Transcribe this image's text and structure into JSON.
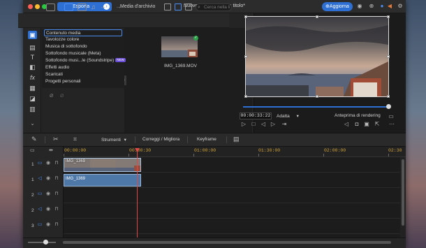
{
  "titlebar": {
    "export_label": "Esporta",
    "export_chevron": "›",
    "project_title": "Nuovo progetto senza titolo*",
    "update_label": "⊕Aggiorna",
    "back_icon": "←",
    "forward_icon": "→"
  },
  "library": {
    "view_dropdown": "Media d'archivio",
    "search_placeholder": "Cerca nella li",
    "categories": [
      "Contenuto media",
      "Tavolozze colore",
      "Musica di sottofondo",
      "Sottofondo musicale (Meta)",
      "Sottofondo musi...le (Soundstripe)",
      "Effetti audio",
      "Scaricati",
      "Progetti personali"
    ],
    "new_badge": "NEW",
    "media_item_label": "IMG_1369.MOV"
  },
  "preview": {
    "timecode": "00:00:33:22",
    "fit_label": "Adatta",
    "fit_chevron": "▾",
    "render_label": "Anteprima di rendering"
  },
  "timeline_toolbar": {
    "tools_label": "Strumenti",
    "tools_chevron": "▾",
    "correct_label": "Correggi / Migliora",
    "keyframe_label": "Keyframe"
  },
  "ruler": {
    "labels": [
      "00:00:00",
      "00:00:30",
      "01:00:00",
      "01:30:00",
      "02:00:00",
      "02:30"
    ]
  },
  "tracks": {
    "rows": [
      "1",
      "1",
      "2",
      "2",
      "3"
    ],
    "video_clip_label": "IMG_1369",
    "audio_clip_label": "IMG_1369"
  },
  "colors": {
    "accent": "#2d6fd3",
    "clip_video": "#5f88b8",
    "clip_audio": "#4d78a8",
    "playhead": "#e04848",
    "ruler_text": "#d0a23a"
  }
}
